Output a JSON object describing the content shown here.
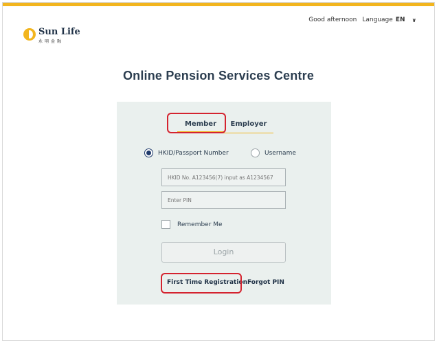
{
  "brand": {
    "name": "Sun Life",
    "subtitle": "永明金融"
  },
  "header": {
    "greeting": "Good afternoon",
    "language_label": "Language",
    "language_value": "EN",
    "language_icon": "chevron-down-icon"
  },
  "page": {
    "title": "Online Pension Services Centre"
  },
  "login_panel": {
    "tabs": [
      {
        "label": "Member",
        "selected": true
      },
      {
        "label": "Employer",
        "selected": false
      }
    ],
    "id_type_options": [
      {
        "label": "HKID/Passport Number",
        "selected": true
      },
      {
        "label": "Username",
        "selected": false
      }
    ],
    "id_input": {
      "placeholder": "HKID No. A123456(7) input as A1234567",
      "value": ""
    },
    "pin_input": {
      "placeholder": "Enter PIN",
      "value": ""
    },
    "remember_me": {
      "label": "Remember Me",
      "checked": false
    },
    "login_button": {
      "label": "Login"
    },
    "links": [
      {
        "label": "First Time Registration"
      },
      {
        "label": "Forgot PIN"
      }
    ]
  },
  "colors": {
    "accent": "#f2b51e",
    "highlight": "#d4232f",
    "panel": "#eaf0ee",
    "text": "#2c3e50"
  }
}
